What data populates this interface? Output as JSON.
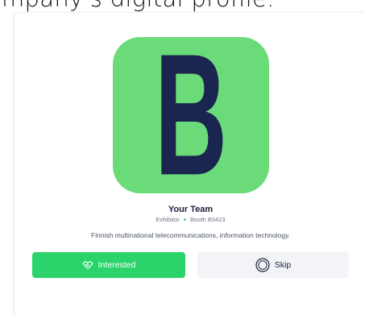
{
  "heading": {
    "text": "mpany's digital profile."
  },
  "card": {
    "logo": {
      "letter": "B",
      "background": "#6bdb7a",
      "letter_color": "#1a2550"
    },
    "team_name": "Your Team",
    "meta": {
      "role": "Exhibitor",
      "separator": "•",
      "booth": "Booth B3423"
    },
    "description": "Finnish multinational telecommunications, information technology.",
    "actions": {
      "interested": {
        "label": "Interested",
        "icon": "handshake-icon",
        "color": "#2bd46a"
      },
      "skip": {
        "label": "Skip",
        "icon": "skip-circle-icon"
      }
    }
  }
}
